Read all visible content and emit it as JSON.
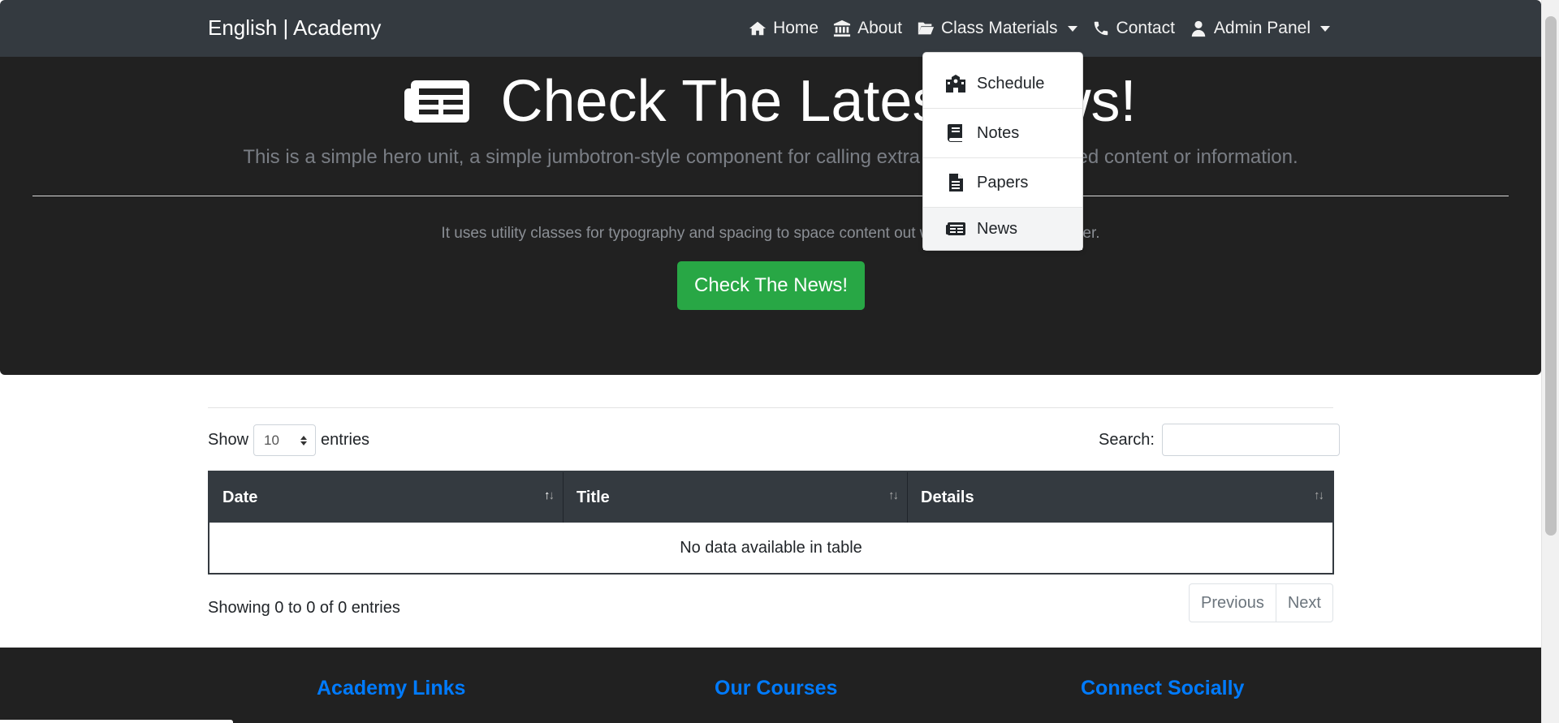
{
  "navbar": {
    "brand": "English | Academy",
    "items": [
      {
        "label": "Home",
        "icon": "home-icon"
      },
      {
        "label": "About",
        "icon": "bank-icon"
      },
      {
        "label": "Class Materials",
        "icon": "folder-open-icon",
        "dropdown": true
      },
      {
        "label": "Contact",
        "icon": "phone-icon"
      },
      {
        "label": "Admin Panel",
        "icon": "user-icon",
        "dropdown": true
      }
    ]
  },
  "dropdown": {
    "items": [
      {
        "label": "Schedule",
        "icon": "school-icon"
      },
      {
        "label": "Notes",
        "icon": "book-icon"
      },
      {
        "label": "Papers",
        "icon": "file-icon"
      },
      {
        "label": "News",
        "icon": "newspaper-icon"
      }
    ]
  },
  "hero": {
    "title": "Check The Latest News!",
    "lead": "This is a simple hero unit, a simple jumbotron-style component for calling extra attention to featured content or information.",
    "sub": "It uses utility classes for typography and spacing to space content out within the larger container.",
    "cta": "Check The News!"
  },
  "table_controls": {
    "show_label": "Show",
    "entries_value": "10",
    "entries_label": "entries",
    "search_label": "Search:"
  },
  "table": {
    "columns": [
      "Date",
      "Title",
      "Details"
    ],
    "empty": "No data available in table"
  },
  "pagination": {
    "info": "Showing 0 to 0 of 0 entries",
    "previous": "Previous",
    "next": "Next"
  },
  "footer": {
    "columns": [
      "Academy Links",
      "Our Courses",
      "Connect Socially"
    ]
  },
  "colors": {
    "navbar": "#343a40",
    "hero": "#212121",
    "cta": "#28a745",
    "footer_heading": "#007bff"
  }
}
